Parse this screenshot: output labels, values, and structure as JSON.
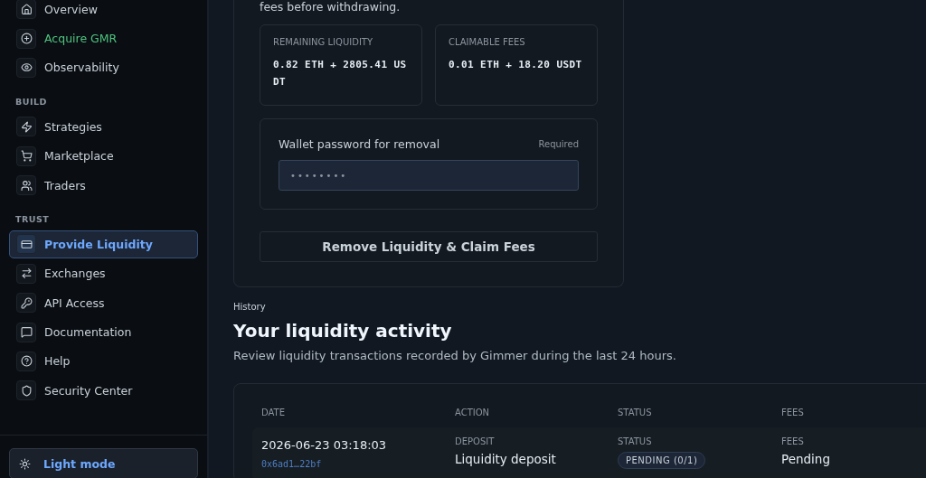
{
  "sidebar": {
    "groups": [
      {
        "items": [
          {
            "label": "Overview",
            "kind": "link",
            "selected": false
          },
          {
            "label": "Acquire GMR",
            "kind": "promo",
            "selected": false
          },
          {
            "label": "Observability",
            "kind": "link",
            "selected": false
          }
        ]
      },
      {
        "heading": "BUILD",
        "items": [
          {
            "label": "Strategies",
            "kind": "link",
            "selected": false
          },
          {
            "label": "Marketplace",
            "kind": "link",
            "selected": false
          },
          {
            "label": "Traders",
            "kind": "link",
            "selected": false
          }
        ]
      },
      {
        "heading": "TRUST",
        "items": [
          {
            "label": "Provide Liquidity",
            "kind": "link",
            "selected": true
          },
          {
            "label": "Exchanges",
            "kind": "link",
            "selected": false
          },
          {
            "label": "API Access",
            "kind": "link",
            "selected": false
          },
          {
            "label": "Documentation",
            "kind": "link",
            "selected": false
          },
          {
            "label": "Help",
            "kind": "link",
            "selected": false
          },
          {
            "label": "Security Center",
            "kind": "link",
            "selected": false
          }
        ]
      }
    ],
    "theme_button": "Light mode"
  },
  "withdraw_card": {
    "note": "fees before withdrawing.",
    "stats": [
      {
        "label": "REMAINING LIQUIDITY",
        "value": "0.82 ETH + 2805.41 USDT"
      },
      {
        "label": "CLAIMABLE FEES",
        "value": "0.01 ETH + 18.20 USDT"
      }
    ],
    "password": {
      "label": "Wallet password for removal",
      "hint": "Required",
      "value": "••••••••"
    },
    "button": "Remove Liquidity & Claim Fees"
  },
  "history": {
    "eyebrow": "History",
    "title": "Your liquidity activity",
    "description": "Review liquidity transactions recorded by Gimmer during the last 24 hours.",
    "columns": [
      "DATE",
      "ACTION",
      "STATUS",
      "FEES"
    ],
    "rows": [
      {
        "date": "2026-06-23 03:18:03",
        "hash": "0x6ad1…22bf",
        "action_label": "DEPOSIT",
        "action": "Liquidity deposit",
        "status_label": "STATUS",
        "status": "PENDING (0/1)",
        "fees_label": "FEES",
        "fees": "Pending"
      }
    ]
  }
}
